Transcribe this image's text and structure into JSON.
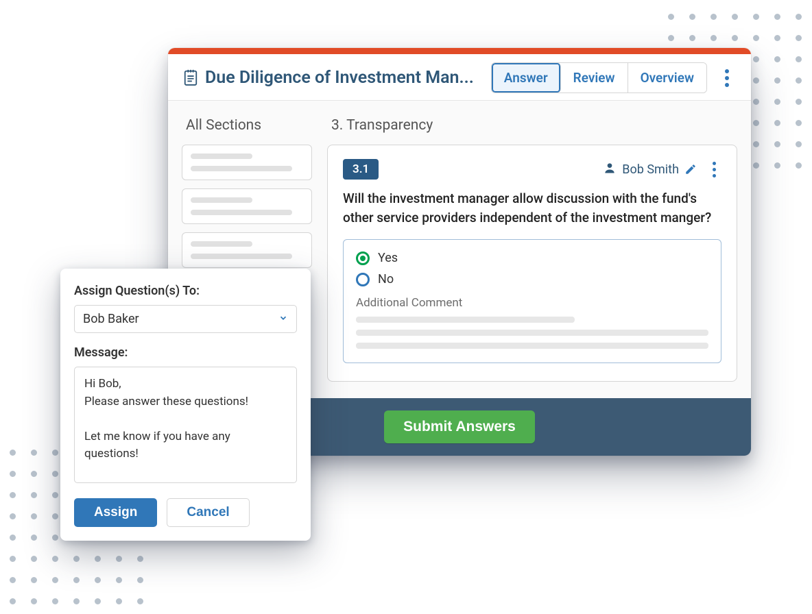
{
  "header": {
    "title": "Due Diligence of Investment Man...",
    "tabs": [
      {
        "label": "Answer",
        "active": true
      },
      {
        "label": "Review",
        "active": false
      },
      {
        "label": "Overview",
        "active": false
      }
    ]
  },
  "sidebar": {
    "heading": "All Sections"
  },
  "content": {
    "section_heading": "3. Transparency",
    "question": {
      "badge": "3.1",
      "assignee_name": "Bob Smith",
      "text": "Will the investment manager allow discussion with the fund's other service providers independent of the investment manger?",
      "options": [
        {
          "label": "Yes",
          "selected": true
        },
        {
          "label": "No",
          "selected": false
        }
      ],
      "comment_label": "Additional Comment"
    }
  },
  "footer": {
    "submit_label": "Submit Answers"
  },
  "dialog": {
    "assign_label": "Assign Question(s) To:",
    "selected_assignee": "Bob Baker",
    "message_label": "Message:",
    "message_value": "Hi Bob,\nPlease answer these questions!\n\nLet me know if you have any questions!",
    "assign_button": "Assign",
    "cancel_button": "Cancel"
  }
}
